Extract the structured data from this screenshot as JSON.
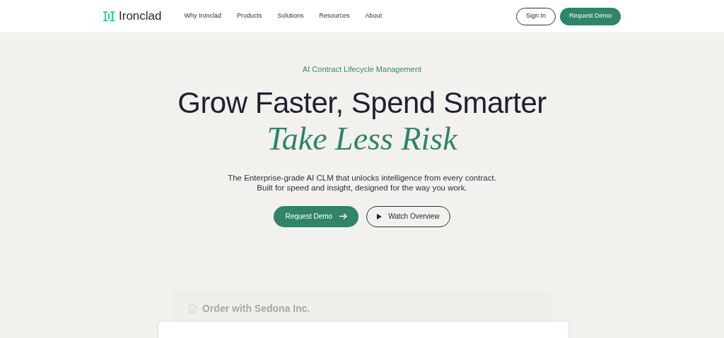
{
  "nav": {
    "brand": "Ironclad",
    "links": [
      "Why Ironclad",
      "Products",
      "Solutions",
      "Resources",
      "About"
    ],
    "sign_in": "Sign In",
    "request_demo": "Request Demo"
  },
  "hero": {
    "eyebrow": "AI Contract Lifecycle Management",
    "headline": "Grow Faster, Spend Smarter",
    "headline_accent": "Take Less Risk",
    "description": [
      "The Enterprise-grade AI CLM that unlocks intelligence from every contract.",
      "Built for speed and insight, designed for the way you work."
    ],
    "primary_button": "Request Demo",
    "secondary_button": "Watch Overview"
  },
  "preview": {
    "document_title": "Order with Sedona Inc."
  }
}
